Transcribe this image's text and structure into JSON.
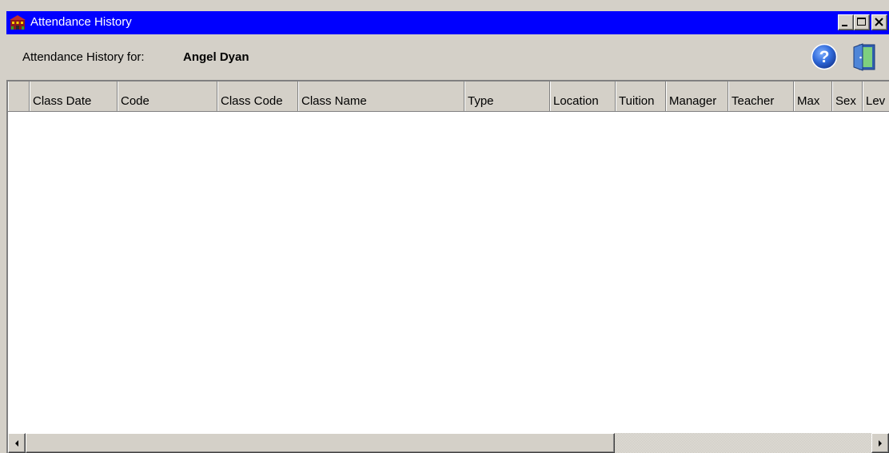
{
  "window": {
    "title": "Attendance History",
    "app_icon": "school-building-icon",
    "buttons": [
      "minimize-icon",
      "maximize-icon",
      "close-icon"
    ],
    "title_bar_color": "#0000ff"
  },
  "header": {
    "label": "Attendance History for:",
    "name": "Angel Dyan",
    "help_icon": "help-question-icon",
    "exit_icon": "exit-door-icon"
  },
  "grid": {
    "columns": [
      "",
      "Class Date",
      "Code",
      "Class Code",
      "Class Name",
      "Type",
      "Location",
      "Tuition",
      "Manager",
      "Teacher",
      "Max",
      "Sex",
      "Lev"
    ],
    "rows": []
  },
  "scrollbar": {
    "left_icon": "arrow-left-icon",
    "right_icon": "arrow-right-icon"
  }
}
